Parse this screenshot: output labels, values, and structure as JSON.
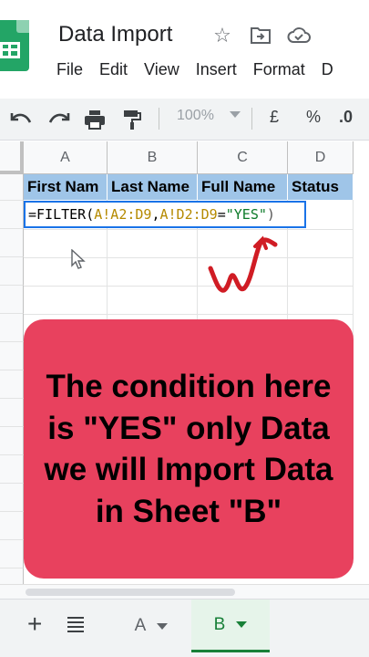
{
  "app": {
    "doc_title": "Data Import",
    "icons": [
      "star-icon",
      "move-to-folder-icon",
      "cloud-saved-icon"
    ]
  },
  "menu": [
    "File",
    "Edit",
    "View",
    "Insert",
    "Format",
    "D"
  ],
  "toolbar": {
    "zoom": "100%",
    "currency": "£",
    "percent": "%",
    "decimal": ".0"
  },
  "sheet": {
    "columns": [
      "A",
      "B",
      "C",
      "D"
    ],
    "header_row": [
      "First Nam",
      "Last Name",
      "Full Name",
      "Status"
    ],
    "formula": {
      "prefix": "=FILTER(",
      "range1": "A!A2:D9",
      "sep": ",",
      "range2": "A!D2:D9",
      "eq": "=",
      "criterion": "\"YES\"",
      "close": ")"
    },
    "header_color": "#9fc5e8",
    "active_border_color": "#1a73e8"
  },
  "callout": {
    "text": "The condition here is \"YES\" only Data we will Import Data in Sheet \"B\"",
    "color": "#e8415e"
  },
  "sheet_tabs": [
    {
      "label": "A",
      "active": false
    },
    {
      "label": "B",
      "active": true
    }
  ]
}
